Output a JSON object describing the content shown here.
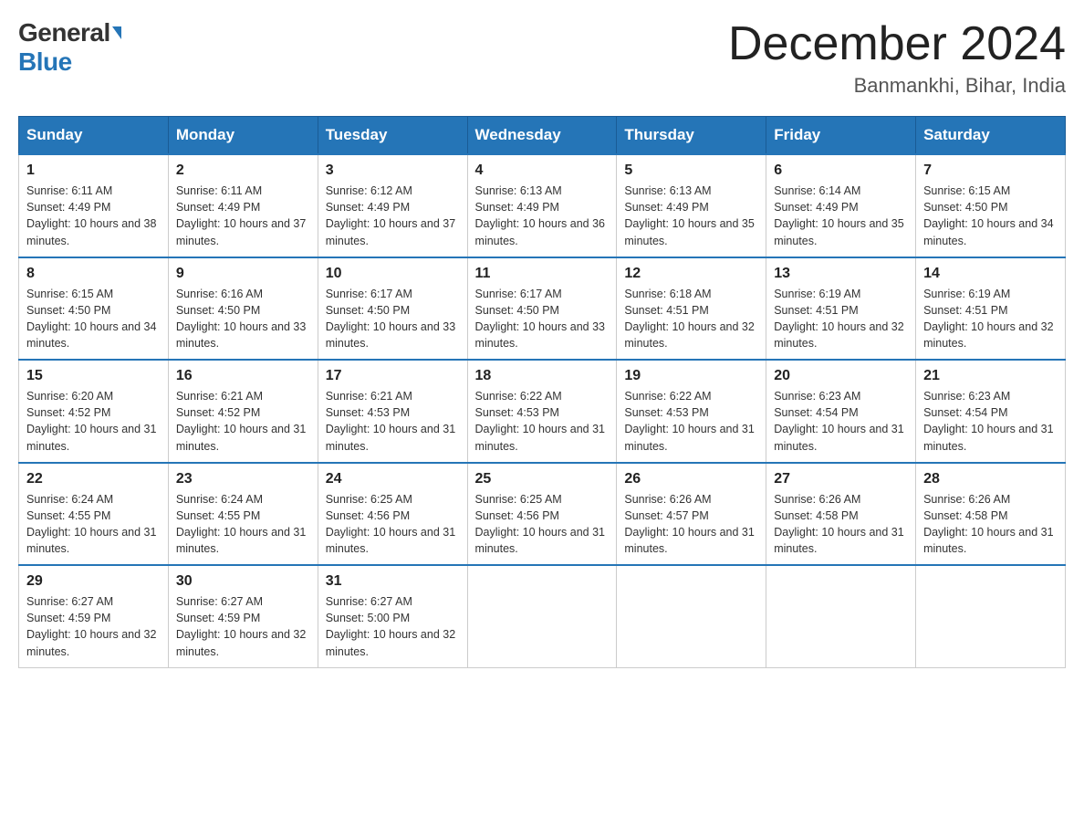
{
  "logo": {
    "general": "General",
    "blue": "Blue"
  },
  "title": {
    "month": "December 2024",
    "location": "Banmankhi, Bihar, India"
  },
  "days": [
    "Sunday",
    "Monday",
    "Tuesday",
    "Wednesday",
    "Thursday",
    "Friday",
    "Saturday"
  ],
  "weeks": [
    [
      {
        "day": "1",
        "sunrise": "6:11 AM",
        "sunset": "4:49 PM",
        "daylight": "10 hours and 38 minutes."
      },
      {
        "day": "2",
        "sunrise": "6:11 AM",
        "sunset": "4:49 PM",
        "daylight": "10 hours and 37 minutes."
      },
      {
        "day": "3",
        "sunrise": "6:12 AM",
        "sunset": "4:49 PM",
        "daylight": "10 hours and 37 minutes."
      },
      {
        "day": "4",
        "sunrise": "6:13 AM",
        "sunset": "4:49 PM",
        "daylight": "10 hours and 36 minutes."
      },
      {
        "day": "5",
        "sunrise": "6:13 AM",
        "sunset": "4:49 PM",
        "daylight": "10 hours and 35 minutes."
      },
      {
        "day": "6",
        "sunrise": "6:14 AM",
        "sunset": "4:49 PM",
        "daylight": "10 hours and 35 minutes."
      },
      {
        "day": "7",
        "sunrise": "6:15 AM",
        "sunset": "4:50 PM",
        "daylight": "10 hours and 34 minutes."
      }
    ],
    [
      {
        "day": "8",
        "sunrise": "6:15 AM",
        "sunset": "4:50 PM",
        "daylight": "10 hours and 34 minutes."
      },
      {
        "day": "9",
        "sunrise": "6:16 AM",
        "sunset": "4:50 PM",
        "daylight": "10 hours and 33 minutes."
      },
      {
        "day": "10",
        "sunrise": "6:17 AM",
        "sunset": "4:50 PM",
        "daylight": "10 hours and 33 minutes."
      },
      {
        "day": "11",
        "sunrise": "6:17 AM",
        "sunset": "4:50 PM",
        "daylight": "10 hours and 33 minutes."
      },
      {
        "day": "12",
        "sunrise": "6:18 AM",
        "sunset": "4:51 PM",
        "daylight": "10 hours and 32 minutes."
      },
      {
        "day": "13",
        "sunrise": "6:19 AM",
        "sunset": "4:51 PM",
        "daylight": "10 hours and 32 minutes."
      },
      {
        "day": "14",
        "sunrise": "6:19 AM",
        "sunset": "4:51 PM",
        "daylight": "10 hours and 32 minutes."
      }
    ],
    [
      {
        "day": "15",
        "sunrise": "6:20 AM",
        "sunset": "4:52 PM",
        "daylight": "10 hours and 31 minutes."
      },
      {
        "day": "16",
        "sunrise": "6:21 AM",
        "sunset": "4:52 PM",
        "daylight": "10 hours and 31 minutes."
      },
      {
        "day": "17",
        "sunrise": "6:21 AM",
        "sunset": "4:53 PM",
        "daylight": "10 hours and 31 minutes."
      },
      {
        "day": "18",
        "sunrise": "6:22 AM",
        "sunset": "4:53 PM",
        "daylight": "10 hours and 31 minutes."
      },
      {
        "day": "19",
        "sunrise": "6:22 AM",
        "sunset": "4:53 PM",
        "daylight": "10 hours and 31 minutes."
      },
      {
        "day": "20",
        "sunrise": "6:23 AM",
        "sunset": "4:54 PM",
        "daylight": "10 hours and 31 minutes."
      },
      {
        "day": "21",
        "sunrise": "6:23 AM",
        "sunset": "4:54 PM",
        "daylight": "10 hours and 31 minutes."
      }
    ],
    [
      {
        "day": "22",
        "sunrise": "6:24 AM",
        "sunset": "4:55 PM",
        "daylight": "10 hours and 31 minutes."
      },
      {
        "day": "23",
        "sunrise": "6:24 AM",
        "sunset": "4:55 PM",
        "daylight": "10 hours and 31 minutes."
      },
      {
        "day": "24",
        "sunrise": "6:25 AM",
        "sunset": "4:56 PM",
        "daylight": "10 hours and 31 minutes."
      },
      {
        "day": "25",
        "sunrise": "6:25 AM",
        "sunset": "4:56 PM",
        "daylight": "10 hours and 31 minutes."
      },
      {
        "day": "26",
        "sunrise": "6:26 AM",
        "sunset": "4:57 PM",
        "daylight": "10 hours and 31 minutes."
      },
      {
        "day": "27",
        "sunrise": "6:26 AM",
        "sunset": "4:58 PM",
        "daylight": "10 hours and 31 minutes."
      },
      {
        "day": "28",
        "sunrise": "6:26 AM",
        "sunset": "4:58 PM",
        "daylight": "10 hours and 31 minutes."
      }
    ],
    [
      {
        "day": "29",
        "sunrise": "6:27 AM",
        "sunset": "4:59 PM",
        "daylight": "10 hours and 32 minutes."
      },
      {
        "day": "30",
        "sunrise": "6:27 AM",
        "sunset": "4:59 PM",
        "daylight": "10 hours and 32 minutes."
      },
      {
        "day": "31",
        "sunrise": "6:27 AM",
        "sunset": "5:00 PM",
        "daylight": "10 hours and 32 minutes."
      },
      null,
      null,
      null,
      null
    ]
  ]
}
